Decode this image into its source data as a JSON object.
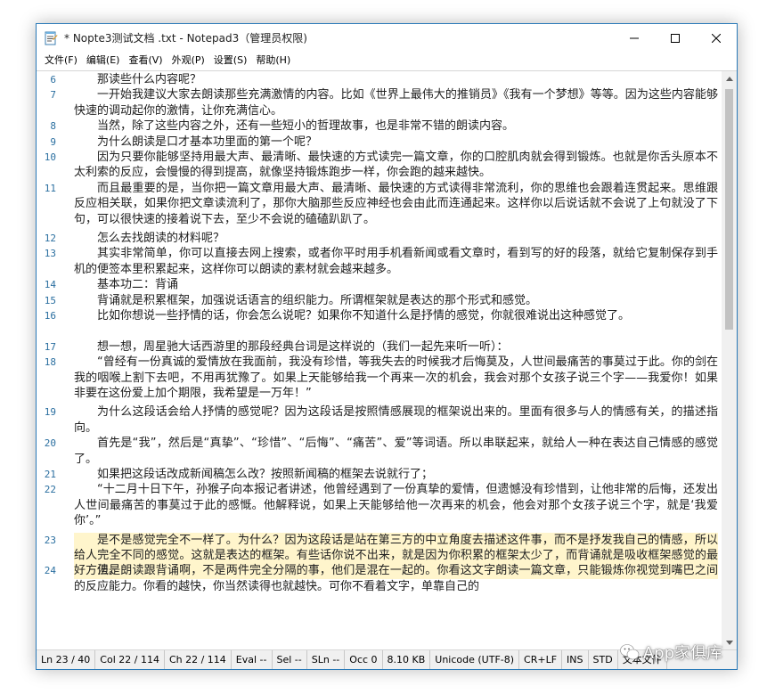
{
  "window": {
    "title": "* Nopte3测试文档 .txt - Notepad3（管理员权限)"
  },
  "menu": [
    "文件(F)",
    "编辑(E)",
    "查看(V)",
    "外观(P)",
    "设置(S)",
    "帮助(H)"
  ],
  "lines": [
    {
      "no": "6",
      "text": "那读些什么内容呢？"
    },
    {
      "no": "7",
      "text": "一开始我建议大家去朗读那些充满激情的内容。比如《世界上最伟大的推销员》《我有一个梦想》等等。因为这些内容能够快速的调动起你的激情，让你充满信心。"
    },
    {
      "no": "8",
      "text": "当然，除了这些内容之外，还有一些短小的哲理故事，也是非常不错的朗读内容。"
    },
    {
      "no": "9",
      "text": "为什么朗读是口才基本功里面的第一个呢？"
    },
    {
      "no": "10",
      "text": "因为只要你能够坚持用最大声、最清晰、最快速的方式读完一篇文章，你的口腔肌肉就会得到锻炼。也就是你舌头原本不太利索的反应，会慢慢的得到提高，就像坚持锻炼跑步一样，你会跑的越来越快。"
    },
    {
      "no": "11",
      "text": "而且最重要的是，当你把一篇文章用最大声、最清晰、最快速的方式读得非常流利，你的思维也会跟着连贯起来。思维跟反应相关联，如果你把文章读流利了，那你大脑那些反应神经也会由此而连通起来。这样你以后说话就不会说了上句就没了下句，可以很快速的接着说下去，至少不会说的磕磕趴趴了。"
    },
    {
      "no": "12",
      "text": "怎么去找朗读的材料呢？"
    },
    {
      "no": "13",
      "text": "其实非常简单，你可以直接去网上搜索，或者你平时用手机看新闻或看文章时，看到写的好的段落，就给它复制保存到手机的便签本里积累起来，这样你可以朗读的素材就会越来越多。"
    },
    {
      "no": "14",
      "text": "基本功二：背诵"
    },
    {
      "no": "15",
      "text": "背诵就是积累框架，加强说话语言的组织能力。所谓框架就是表达的那个形式和感觉。"
    },
    {
      "no": "16",
      "text": "比如你想说一些抒情的话，你会怎么说呢？如果你不知道什么是抒情的感觉，你就很难说出这种感觉了。"
    },
    {
      "no": "17",
      "text": "想一想，周星驰大话西游里的那段经典台词是这样说的（我们一起先来听一听）："
    },
    {
      "no": "18",
      "text": "“曾经有一份真诚的爱情放在我面前，我没有珍惜，等我失去的时候我才后悔莫及，人世间最痛苦的事莫过于此。你的剑在我的咽喉上割下去吧，不用再犹豫了。如果上天能够给我一个再来一次的机会，我会对那个女孩子说三个字——我爱你！如果非要在这份爱上加个期限，我希望是一万年！”"
    },
    {
      "no": "19",
      "text": "为什么这段话会给人抒情的感觉呢？因为这段话是按照情感展现的框架说出来的。里面有很多与人的情感有关，的描述指向。"
    },
    {
      "no": "20",
      "text": "首先是“我”，然后是“真挚”、“珍惜”、“后悔”、“痛苦”、爱”等词语。所以串联起来，就给人一种在表达自己情感的感觉了。"
    },
    {
      "no": "21",
      "text": "如果把这段话改成新闻稿怎么改？按照新闻稿的框架去说就行了；"
    },
    {
      "no": "22",
      "text": "“十二月十日下午，孙猴子向本报记者讲述，他曾经遇到了一份真挚的爱情，但遗憾没有珍惜到，让他非常的后悔，还发出人世间最痛苦的事莫过于此的感慨。他解释说，如果上天能够给他一次再来的机会，他会对那个女孩子说三个字，就是‘我爱你’。”"
    },
    {
      "no": "23",
      "text": "是不是感觉完全不一样了。为什么？因为这段话是站在第三方的中立角度去描述这件事，而不是抒发我自己的情感，所以给人完全不同的感觉。这就是表达的框架。有些话你说不出来，就是因为你积累的框架太少了，而背诵就是吸收框架感觉的最好方法。"
    },
    {
      "no": "24",
      "text": "但是朗读跟背诵啊，不是两件完全分隔的事，他们是混在一起的。你看这文字朗读一篇文章，只能锻炼你视觉到嘴巴之间的反应能力。你看的越快，你当然读得也就越快。可你不看着文字，单靠自己的"
    }
  ],
  "status": [
    "Ln  23 / 40",
    "Col  22 / 114",
    "Ch  22 / 114",
    "Eval  --",
    "Sel  --",
    "SLn  --",
    "Occ  0",
    "8.10 KB",
    "Unicode (UTF-8)",
    "CR+LF",
    "INS",
    "STD",
    "文本文件"
  ],
  "watermark": "App家俱库"
}
